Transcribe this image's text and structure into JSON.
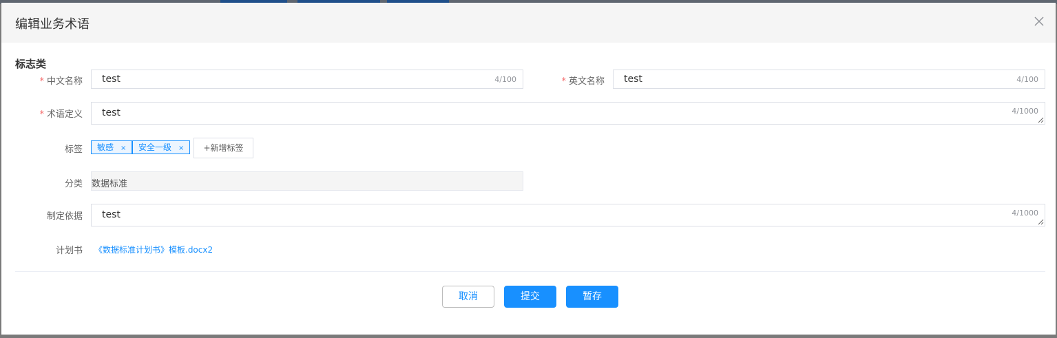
{
  "dialog": {
    "title": "编辑业务术语",
    "close_icon": "close-icon"
  },
  "section": {
    "title": "标志类"
  },
  "form": {
    "cn_name": {
      "label": "中文名称",
      "required": true,
      "value": "test",
      "count": "4/100"
    },
    "en_name": {
      "label": "英文名称",
      "required": true,
      "value": "test",
      "count": "4/100"
    },
    "definition": {
      "label": "术语定义",
      "required": true,
      "value": "test",
      "count": "4/1000"
    },
    "tags": {
      "label": "标签",
      "items": [
        {
          "text": "敏感",
          "close": "×"
        },
        {
          "text": "安全一级",
          "close": "×"
        }
      ],
      "add_label": "+新增标签"
    },
    "category": {
      "label": "分类",
      "value": "数据标准"
    },
    "basis": {
      "label": "制定依据",
      "value": "test",
      "count": "4/1000"
    },
    "plan": {
      "label": "计划书",
      "file": "《数据标准计划书》模板.docx2"
    }
  },
  "footer": {
    "cancel": "取消",
    "submit": "提交",
    "save": "暂存"
  },
  "colors": {
    "primary": "#1890ff",
    "required": "#f56c6c"
  }
}
